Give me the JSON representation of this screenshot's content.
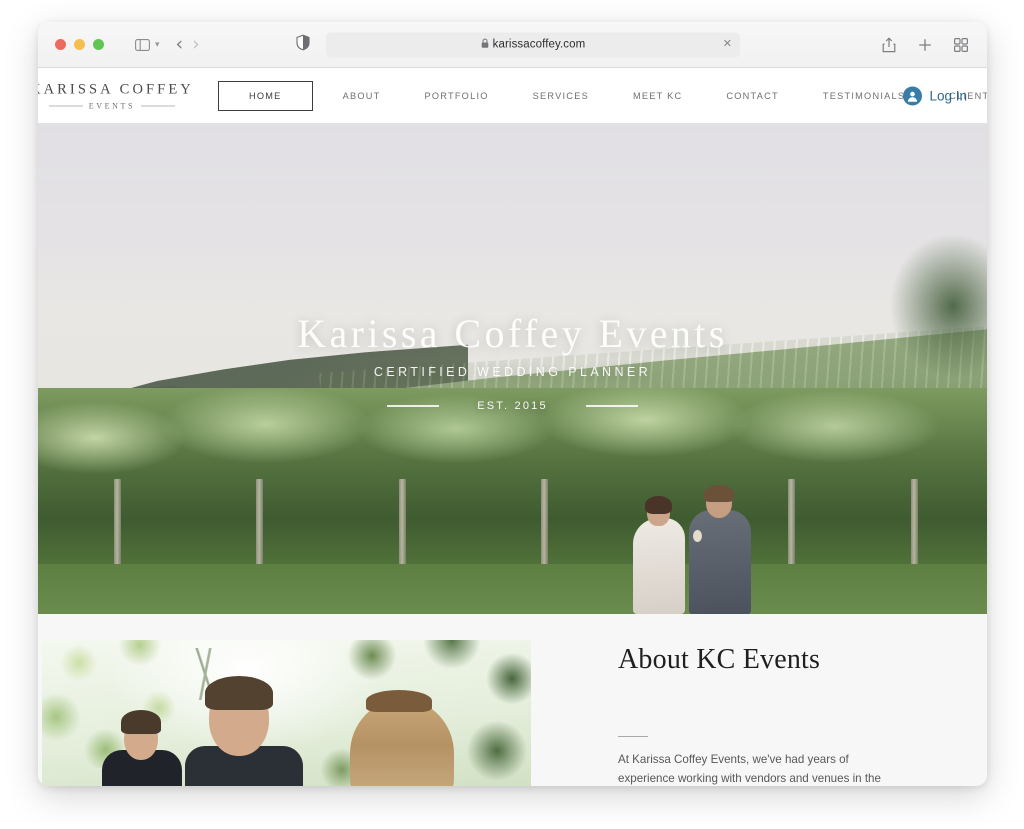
{
  "browser": {
    "traffic_lights": [
      "close",
      "minimize",
      "maximize"
    ],
    "url": "karissacoffey.com",
    "lock_icon": "lock-icon",
    "shield_icon": "privacy-shield-icon",
    "reader_icon": "reader-view-icon",
    "page_settings_icon": "page-settings-icon",
    "sidebar_icon": "sidebar-toggle-icon",
    "sidebar_chevron": "chevron-down-icon",
    "back_icon": "chevron-left-icon",
    "forward_icon": "chevron-right-icon",
    "clear_icon": "close-icon",
    "share_icon": "share-icon",
    "newtab_icon": "plus-icon",
    "tabs_icon": "tab-overview-icon"
  },
  "site": {
    "brand": {
      "name": "KARISSA COFFEY",
      "sub": "EVENTS"
    },
    "nav": [
      {
        "label": "HOME",
        "active": true
      },
      {
        "label": "ABOUT",
        "active": false
      },
      {
        "label": "PORTFOLIO",
        "active": false
      },
      {
        "label": "SERVICES",
        "active": false
      },
      {
        "label": "MEET KC",
        "active": false
      },
      {
        "label": "CONTACT",
        "active": false
      },
      {
        "label": "TESTIMONIALS",
        "active": false
      },
      {
        "label": "CLIENT LOGIN",
        "active": false
      }
    ],
    "login": {
      "label": "Log In",
      "icon": "user-avatar-icon",
      "color": "#2b6690"
    },
    "hero": {
      "title": "Karissa Coffey Events",
      "subtitle": "CERTIFIED WEDDING PLANNER",
      "established": "EST. 2015"
    },
    "about": {
      "title": "About KC Events",
      "body": "At Karissa Coffey Events, we've had years of experience working with vendors and venues in the Charlottesville"
    }
  }
}
